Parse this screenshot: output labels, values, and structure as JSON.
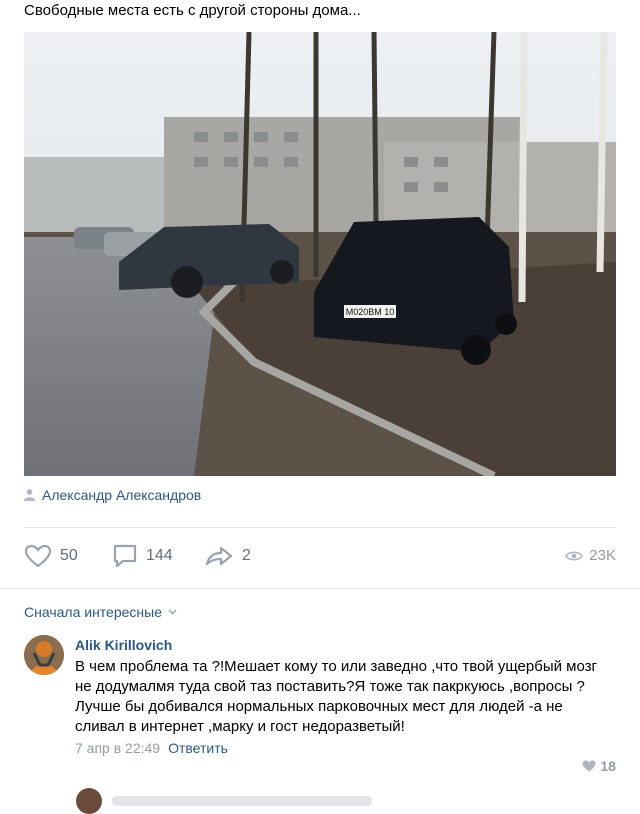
{
  "post": {
    "text": "Свободные места есть с другой стороны дома...",
    "photo": {
      "plate": "М020ВМ 10"
    },
    "author": "Александр Александров"
  },
  "actions": {
    "likes": "50",
    "comments": "144",
    "shares": "2",
    "views": "23K"
  },
  "comments_sort": "Сначала интересные",
  "comment": {
    "author": "Alik Kirillovich",
    "lines": [
      "В чем проблема та ?!Мешает кому то или заведно ,что твой ущербый мозг не додумалмя туда свой таз поставить?Я тоже так пакркуюсь ,вопросы ?",
      "Лучше бы добивался нормальных парковочных мест для людей -а не сливал в интернет ,марку и гост недоразветый!"
    ],
    "date": "7 апр в 22:49",
    "reply_label": "Ответить",
    "likes": "18"
  },
  "colors": {
    "link": "#2a5885",
    "muted": "#939ca5",
    "action": "#626d7a"
  }
}
